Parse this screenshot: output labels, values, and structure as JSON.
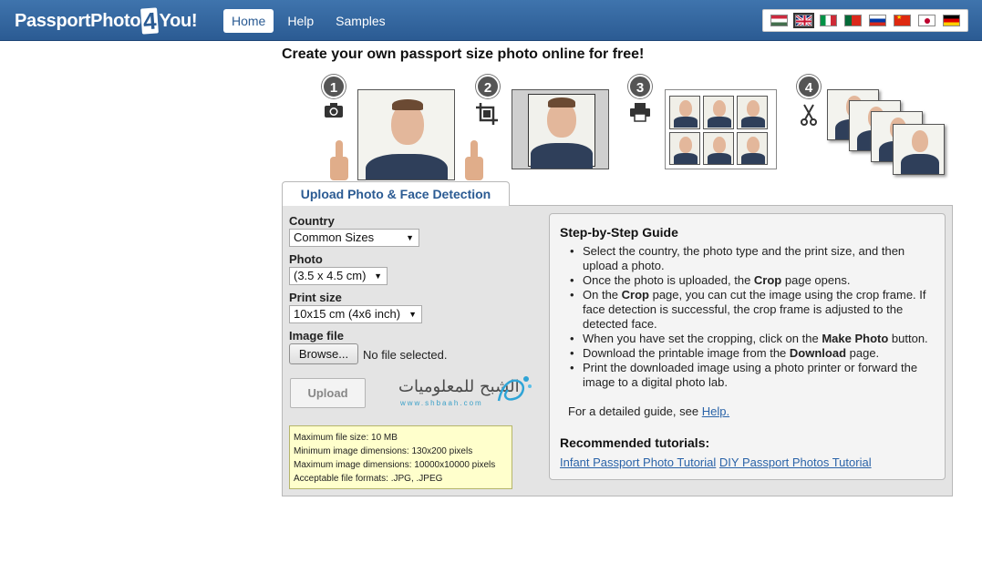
{
  "header": {
    "logo_left": "PassportPhoto",
    "logo_digit": "4",
    "logo_right": "You!",
    "nav": [
      "Home",
      "Help",
      "Samples"
    ],
    "active_nav": "Home",
    "flags": [
      "hungary-flag",
      "uk-flag",
      "italy-flag",
      "portugal-flag",
      "russia-flag",
      "china-flag",
      "japan-flag",
      "germany-flag"
    ],
    "selected_flag": "uk-flag"
  },
  "headline": "Create your own passport size photo online for free!",
  "steps": [
    {
      "num": "1",
      "icon": "camera-icon"
    },
    {
      "num": "2",
      "icon": "crop-icon"
    },
    {
      "num": "3",
      "icon": "printer-icon"
    },
    {
      "num": "4",
      "icon": "scissors-icon"
    }
  ],
  "tab": "Upload Photo & Face Detection",
  "form": {
    "country_label": "Country",
    "country_value": "Common Sizes",
    "photo_label": "Photo",
    "photo_value": "(3.5 x 4.5 cm)",
    "print_label": "Print size",
    "print_value": "10x15 cm (4x6 inch)",
    "file_label": "Image file",
    "browse_label": "Browse...",
    "no_file": "No file selected.",
    "upload_label": "Upload"
  },
  "watermark": {
    "arabic": "الشبح للمعلوميات",
    "site": "www.shbaah.com"
  },
  "info": [
    "Maximum file size: 10 MB",
    "Minimum image dimensions: 130x200 pixels",
    "Maximum image dimensions: 10000x10000 pixels",
    "Acceptable file formats: .JPG, .JPEG"
  ],
  "guide": {
    "title": "Step-by-Step Guide",
    "items": [
      {
        "before": "Select the country, the photo type and the print size, and then upload a photo.",
        "bold": "",
        "after": ""
      },
      {
        "before": "Once the photo is uploaded, the ",
        "bold": "Crop",
        "after": " page opens."
      },
      {
        "before": "On the ",
        "bold": "Crop",
        "after": " page, you can cut the image using the crop frame. If face detection is successful, the crop frame is adjusted to the detected face."
      },
      {
        "before": "When you have set the cropping, click on the ",
        "bold": "Make Photo",
        "after": " button."
      },
      {
        "before": "Download the printable image from the ",
        "bold": "Download",
        "after": " page."
      },
      {
        "before": "Print the downloaded image using a photo printer or forward the image to a digital photo lab.",
        "bold": "",
        "after": ""
      }
    ],
    "see_text": "For a detailed guide, see",
    "see_link": "Help.",
    "tutorials_title": "Recommended tutorials:",
    "tutorial_links": [
      "Infant Passport Photo Tutorial",
      "DIY Passport Photos Tutorial"
    ]
  }
}
